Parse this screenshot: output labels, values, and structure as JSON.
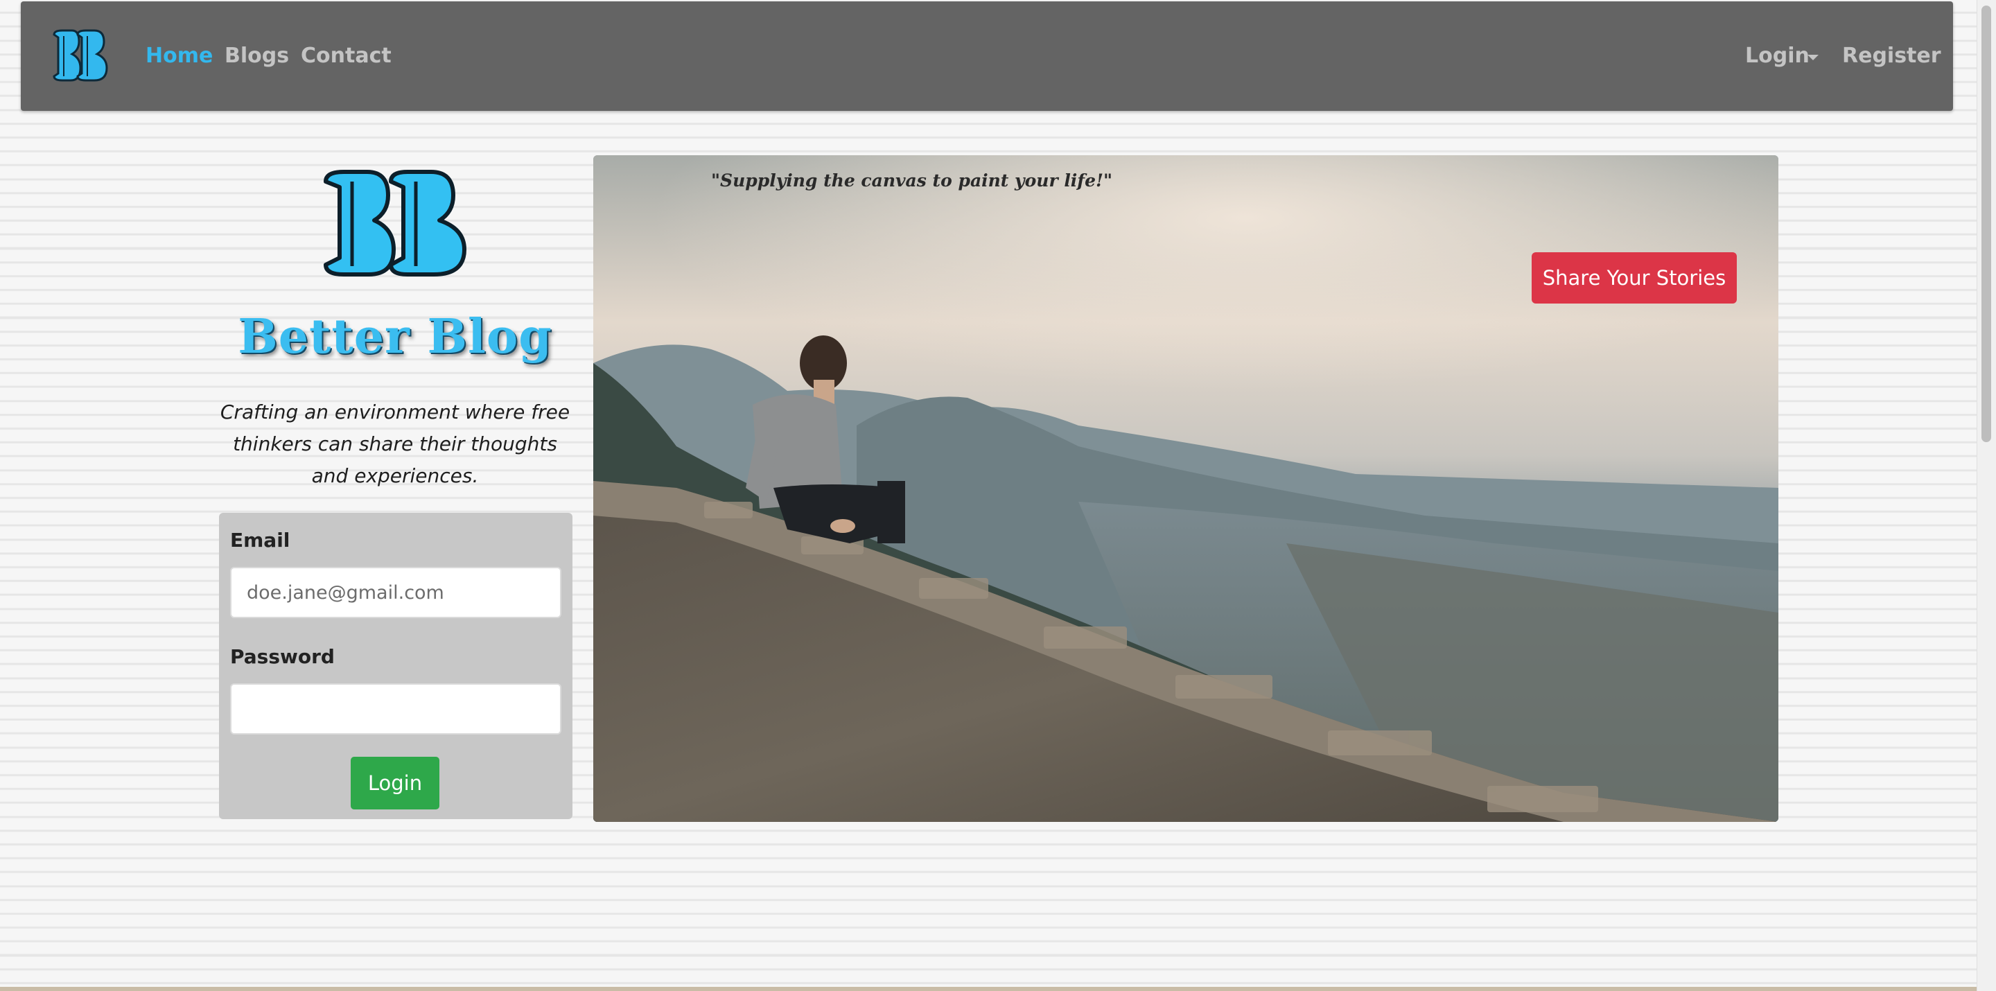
{
  "navbar": {
    "logo_icon": "bb-monogram-logo-icon",
    "links": {
      "home": "Home",
      "blogs": "Blogs",
      "contact": "Contact"
    },
    "active": "Home",
    "login": "Login",
    "register": "Register"
  },
  "brand": {
    "logo_icon": "bb-monogram-logo-icon",
    "title": "Better Blog",
    "tagline": "Crafting an environment where free thinkers can share their thoughts and experiences."
  },
  "login_form": {
    "email_label": "Email",
    "email_placeholder": "doe.jane@gmail.com",
    "password_label": "Password",
    "password_value": "",
    "submit_label": "Login"
  },
  "hero": {
    "quote": "\"Supplying the canvas to paint your life!\"",
    "cta_label": "Share Your Stories",
    "image": "man-sitting-on-stone-wall-overlooking-valley-photo"
  },
  "colors": {
    "navbar_bg": "#646464",
    "nav_active": "#33b8ee",
    "nav_link": "#c4c4c4",
    "brand_blue": "#3bbdf0",
    "login_button": "#2ea84a",
    "share_button": "#dc3547",
    "form_card": "#c7c7c7"
  }
}
